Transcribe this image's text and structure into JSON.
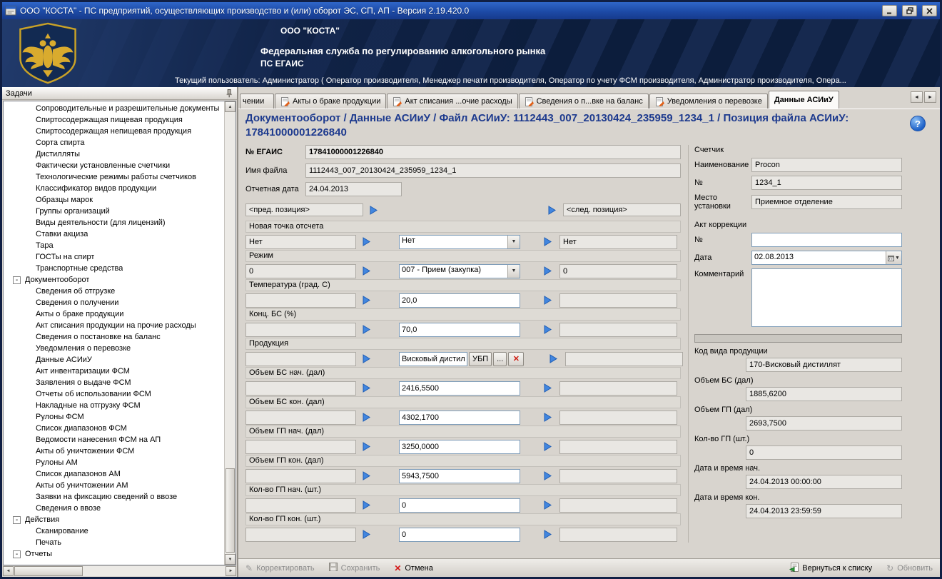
{
  "titlebar": {
    "title": "ООО \"КОСТА\" - ПС предприятий, осуществляющих производство и (или) оборот ЭС, СП, АП - Версия 2.19.420.0"
  },
  "banner": {
    "company": "ООО \"КОСТА\"",
    "agency": "Федеральная служба по регулированию алкогольного рынка",
    "system": "ПС ЕГАИС",
    "user_line": "Текущий пользователь: Администратор ( Оператор производителя, Менеджер печати производителя, Оператор по учету ФСМ производителя, Администратор производителя, Опера..."
  },
  "sidebar": {
    "title": "Задачи",
    "tree": [
      {
        "label": "Сопроводительные и разрешительные документы",
        "level": 2
      },
      {
        "label": "Спиртосодержащая пищевая продукция",
        "level": 2
      },
      {
        "label": "Спиртосодержащая непищевая продукция",
        "level": 2
      },
      {
        "label": "Сорта спирта",
        "level": 2
      },
      {
        "label": "Дистилляты",
        "level": 2
      },
      {
        "label": "Фактически установленные счетчики",
        "level": 2
      },
      {
        "label": "Технологические режимы работы счетчиков",
        "level": 2
      },
      {
        "label": "Классификатор видов продукции",
        "level": 2
      },
      {
        "label": "Образцы марок",
        "level": 2
      },
      {
        "label": "Группы организаций",
        "level": 2
      },
      {
        "label": "Виды деятельности (для лицензий)",
        "level": 2
      },
      {
        "label": "Ставки акциза",
        "level": 2
      },
      {
        "label": "Тара",
        "level": 2
      },
      {
        "label": "ГОСТы на спирт",
        "level": 2
      },
      {
        "label": "Транспортные средства",
        "level": 2
      },
      {
        "label": "Документооборот",
        "level": 1,
        "expander": "minus"
      },
      {
        "label": "Сведения об отгрузке",
        "level": 2
      },
      {
        "label": "Сведения о получении",
        "level": 2
      },
      {
        "label": "Акты о браке продукции",
        "level": 2
      },
      {
        "label": "Акт списания продукции на прочие расходы",
        "level": 2
      },
      {
        "label": "Сведения о постановке на баланс",
        "level": 2
      },
      {
        "label": "Уведомления о перевозке",
        "level": 2
      },
      {
        "label": "Данные АСИиУ",
        "level": 2
      },
      {
        "label": "Акт инвентаризации ФСМ",
        "level": 2
      },
      {
        "label": "Заявления о выдаче ФСМ",
        "level": 2
      },
      {
        "label": "Отчеты об использовании ФСМ",
        "level": 2
      },
      {
        "label": "Накладные на отгрузку ФСМ",
        "level": 2
      },
      {
        "label": "Рулоны ФСМ",
        "level": 2
      },
      {
        "label": "Список диапазонов ФСМ",
        "level": 2
      },
      {
        "label": "Ведомости нанесения ФСМ на АП",
        "level": 2
      },
      {
        "label": "Акты об уничтожении ФСМ",
        "level": 2
      },
      {
        "label": "Рулоны АМ",
        "level": 2
      },
      {
        "label": "Список диапазонов АМ",
        "level": 2
      },
      {
        "label": "Акты об уничтожении АМ",
        "level": 2
      },
      {
        "label": "Заявки на фиксацию сведений о ввозе",
        "level": 2
      },
      {
        "label": "Сведения о ввозе",
        "level": 2
      },
      {
        "label": "Действия",
        "level": 1,
        "expander": "minus"
      },
      {
        "label": "Сканирование",
        "level": 2
      },
      {
        "label": "Печать",
        "level": 2
      },
      {
        "label": "Отчеты",
        "level": 1,
        "expander": "minus"
      }
    ]
  },
  "tabs": {
    "items": [
      {
        "label": "чении",
        "icon": false,
        "active": false,
        "clipped": true
      },
      {
        "label": "Акты о браке продукции",
        "icon": true,
        "active": false
      },
      {
        "label": "Акт списания ...очие расходы",
        "icon": true,
        "active": false
      },
      {
        "label": "Сведения о п...вке на баланс",
        "icon": true,
        "active": false
      },
      {
        "label": "Уведомления о перевозке",
        "icon": true,
        "active": false
      },
      {
        "label": "Данные АСИиУ",
        "icon": false,
        "active": true
      }
    ]
  },
  "content": {
    "breadcrumb": "Документооборот / Данные АСИиУ / Файл АСИиУ: 1112443_007_20130424_235959_1234_1 / Позиция файла АСИиУ: 17841000001226840",
    "help": "?",
    "header_fields": {
      "egais_label": "№ ЕГАИС",
      "egais_value": "17841000001226840",
      "filename_label": "Имя файла",
      "filename_value": "1112443_007_20130424_235959_1234_1",
      "report_date_label": "Отчетная дата",
      "report_date_value": "24.04.2013"
    },
    "nav": {
      "prev": "<пред. позиция>",
      "next": "<след. позиция>"
    },
    "rows": [
      {
        "label": "Новая точка отсчета",
        "left": "Нет",
        "center": "Нет",
        "right": "Нет",
        "type": "select"
      },
      {
        "label": "Режим",
        "left": "0",
        "center": "007 - Прием (закупка)",
        "right": "0",
        "type": "select"
      },
      {
        "label": "Температура (град. С)",
        "left": "",
        "center": "20,0",
        "right": "",
        "type": "text"
      },
      {
        "label": "Конц.  БС (%)",
        "left": "",
        "center": "70,0",
        "right": "",
        "type": "text"
      },
      {
        "label": "Продукция",
        "left": "",
        "center": "Висковый дистил",
        "right": "",
        "type": "product",
        "buttons": [
          "УБП",
          "..."
        ]
      },
      {
        "label": "Объем БС нач. (дал)",
        "left": "",
        "center": "2416,5500",
        "right": "",
        "type": "text"
      },
      {
        "label": "Объем БС кон. (дал)",
        "left": "",
        "center": "4302,1700",
        "right": "",
        "type": "text"
      },
      {
        "label": "Объем ГП нач. (дал)",
        "left": "",
        "center": "3250,0000",
        "right": "",
        "type": "text"
      },
      {
        "label": "Объем ГП кон. (дал)",
        "left": "",
        "center": "5943,7500",
        "right": "",
        "type": "text"
      },
      {
        "label": "Кол-во ГП нач. (шт.)",
        "left": "",
        "center": "0",
        "right": "",
        "type": "text"
      },
      {
        "label": "Кол-во ГП кон. (шт.)",
        "left": "",
        "center": "0",
        "right": "",
        "type": "text"
      }
    ],
    "counter": {
      "title": "Счетчик",
      "name_label": "Наименование",
      "name": "Procon",
      "num_label": "№",
      "num": "1234_1",
      "place_label": "Место установки",
      "place": "Приемное отделение"
    },
    "correction": {
      "title": "Акт коррекции",
      "num_label": "№",
      "num": "",
      "date_label": "Дата",
      "date": "02.08.2013",
      "comment_label": "Комментарий",
      "comment": ""
    },
    "summary": {
      "product_kind_label": "Код вида продукции",
      "product_kind": "170-Висковый дистиллят",
      "vol_bs_label": "Объем БС (дал)",
      "vol_bs": "1885,6200",
      "vol_gp_label": "Объем ГП (дал)",
      "vol_gp": "2693,7500",
      "qty_gp_label": "Кол-во ГП (шт.)",
      "qty_gp": "0",
      "dt_start_label": "Дата и время нач.",
      "dt_start": "24.04.2013 00:00:00",
      "dt_end_label": "Дата и время кон.",
      "dt_end": "24.04.2013 23:59:59"
    }
  },
  "footer": {
    "edit": "Корректировать",
    "save": "Сохранить",
    "cancel": "Отмена",
    "back": "Вернуться к списку",
    "refresh": "Обновить"
  }
}
